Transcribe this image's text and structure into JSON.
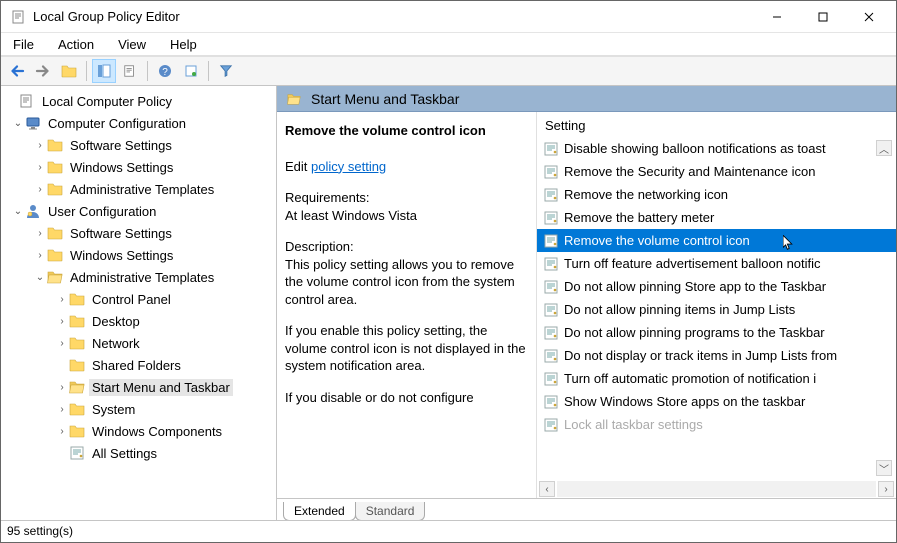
{
  "window_title": "Local Group Policy Editor",
  "menu": [
    "File",
    "Action",
    "View",
    "Help"
  ],
  "tree": {
    "root": "Local Computer Policy",
    "computer": {
      "label": "Computer Configuration",
      "children": [
        "Software Settings",
        "Windows Settings",
        "Administrative Templates"
      ]
    },
    "user": {
      "label": "User Configuration",
      "children_top": [
        "Software Settings",
        "Windows Settings"
      ],
      "admin": {
        "label": "Administrative Templates",
        "children": [
          "Control Panel",
          "Desktop",
          "Network",
          "Shared Folders",
          "Start Menu and Taskbar",
          "System",
          "Windows Components",
          "All Settings"
        ]
      }
    },
    "selected_tree_item": "Start Menu and Taskbar"
  },
  "pane": {
    "header": "Start Menu and Taskbar",
    "policy_name": "Remove the volume control icon",
    "edit_prefix": "Edit ",
    "edit_link": "policy setting",
    "requirements_label": "Requirements:",
    "requirements_value": "At least Windows Vista",
    "description_label": "Description:",
    "description_p1": "This policy setting allows you to remove the volume control icon from the system control area.",
    "description_p2": "If you enable this policy setting, the volume control icon is not displayed in the system notification area.",
    "description_p3": "If you disable or do not configure",
    "column_header": "Setting",
    "settings": [
      "Disable showing balloon notifications as toast",
      "Remove the Security and Maintenance icon",
      "Remove the networking icon",
      "Remove the battery meter",
      "Remove the volume control icon",
      "Turn off feature advertisement balloon notific",
      "Do not allow pinning Store app to the Taskbar",
      "Do not allow pinning items in Jump Lists",
      "Do not allow pinning programs to the Taskbar",
      "Do not display or track items in Jump Lists from",
      "Turn off automatic promotion of notification i",
      "Show Windows Store apps on the taskbar",
      "Lock all taskbar settings"
    ],
    "selected_setting_index": 4,
    "tabs": [
      "Extended",
      "Standard"
    ],
    "active_tab": 0
  },
  "status": "95 setting(s)"
}
